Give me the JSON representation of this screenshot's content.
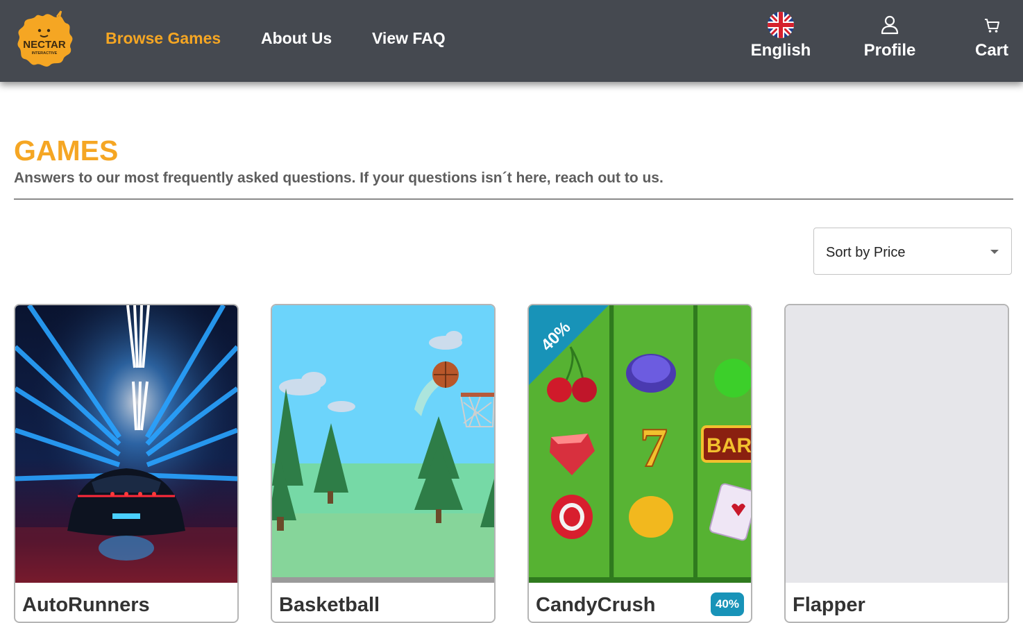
{
  "header": {
    "logo_text": "NECTAR",
    "logo_subtext": "INTERACTIVE",
    "nav": [
      {
        "label": "Browse Games",
        "active": true
      },
      {
        "label": "About Us",
        "active": false
      },
      {
        "label": "View FAQ",
        "active": false
      }
    ],
    "language": {
      "label": "English",
      "icon": "uk-flag-icon"
    },
    "profile": {
      "label": "Profile",
      "icon": "user-icon"
    },
    "cart": {
      "label": "Cart",
      "icon": "cart-icon"
    }
  },
  "page": {
    "title": "GAMES",
    "subtitle": "Answers to our most frequently asked questions. If your questions isn´t here, reach out to us."
  },
  "sort": {
    "selected": "Sort by Price"
  },
  "games": [
    {
      "name": "AutoRunners",
      "discount": null
    },
    {
      "name": "Basketball",
      "discount": null
    },
    {
      "name": "CandyCrush",
      "discount": "40%",
      "ribbon": "40%"
    },
    {
      "name": "Flapper",
      "discount": null
    }
  ],
  "colors": {
    "header_bg": "#454950",
    "accent": "#f5a623",
    "badge": "#1893b8",
    "text_dark": "#333333",
    "subtitle": "#5d5d5d"
  }
}
